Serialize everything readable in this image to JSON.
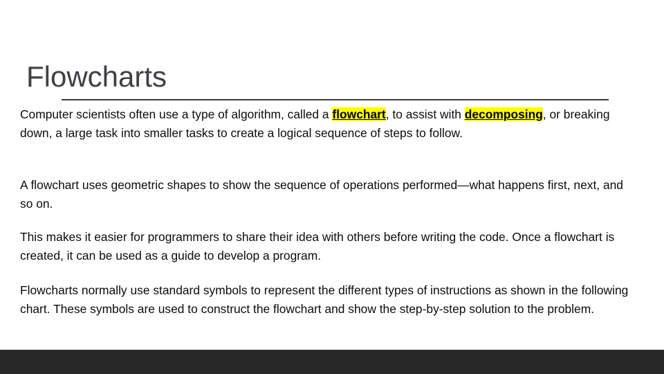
{
  "slide": {
    "title": "Flowcharts",
    "background_color": "#ffffff",
    "title_color": "#404044",
    "rule_color": "#3a3a3a",
    "highlight_color": "#ffff00",
    "footer_color": "#282828",
    "body_text_color": "#0c0c0c"
  },
  "paragraphs": {
    "p1": {
      "seg1": "Computer scientists often use a type of algorithm, called a ",
      "hl1": "flowchart",
      "seg2": ", to assist with ",
      "hl2": "decomposing",
      "seg3": ", or breaking down, a large task into smaller tasks to create a logical sequence of steps to follow."
    },
    "p2": "A flowchart uses geometric shapes to show the sequence of operations performed—what happens first, next, and so on.",
    "p3": "This makes it easier for programmers to share their idea with others before writing the code. Once a flowchart is created, it can be used as a guide to develop a program.",
    "p4": "Flowcharts normally use standard symbols to represent the different types of instructions as shown in the following chart. These symbols are used to construct the flowchart and show the step-by-step solution to the problem."
  }
}
